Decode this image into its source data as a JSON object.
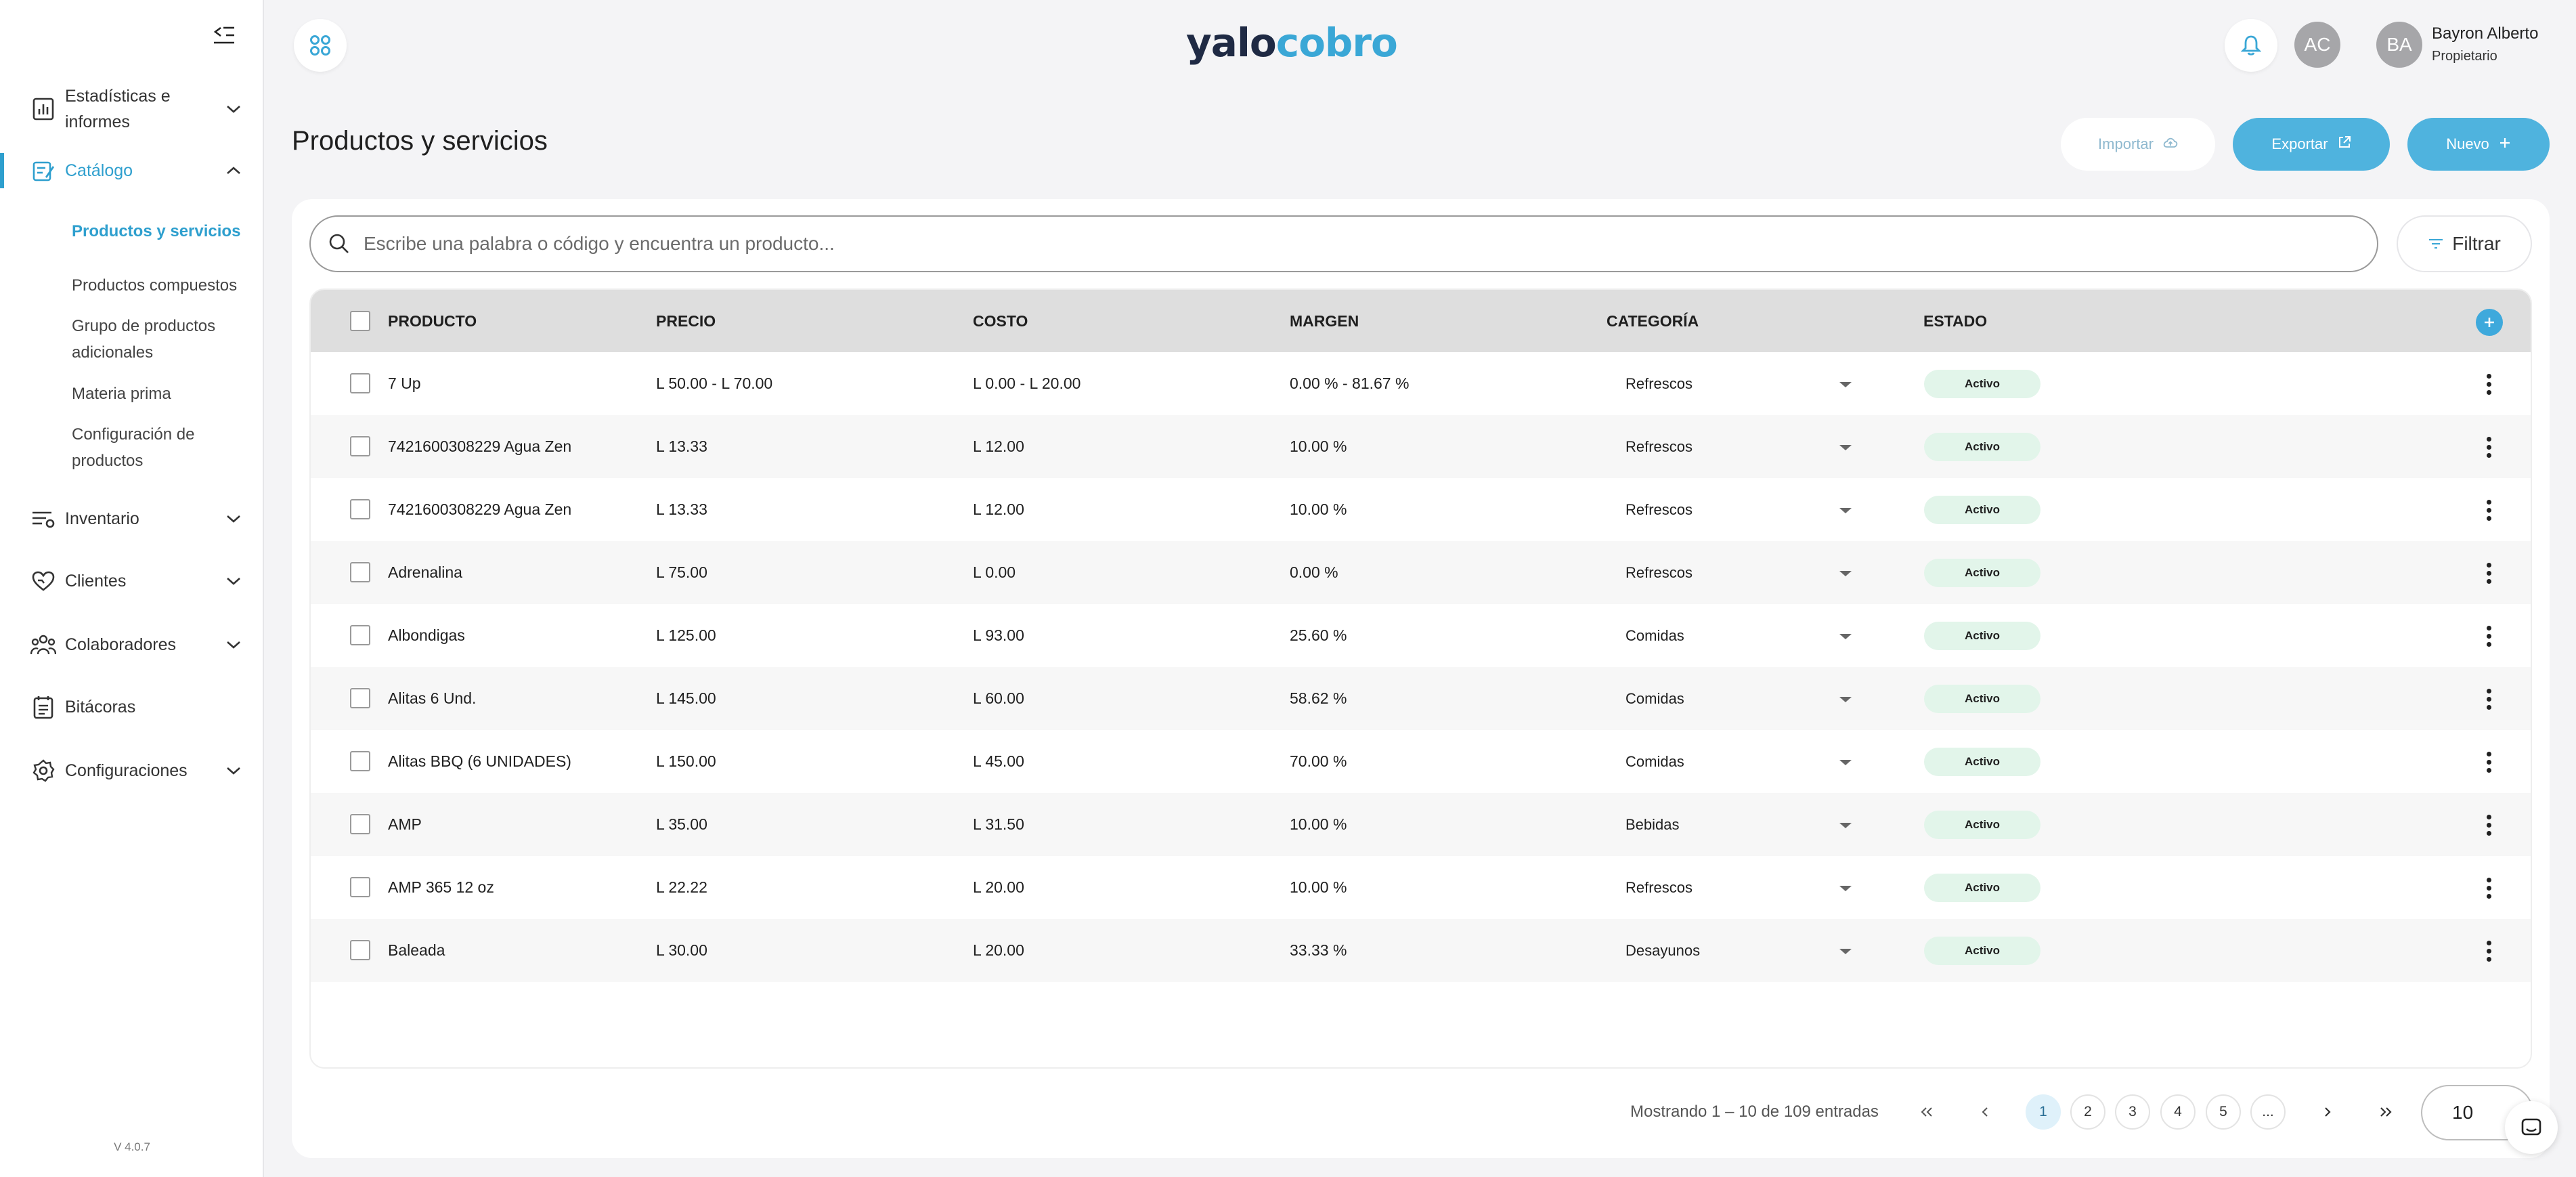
{
  "app": {
    "logo_part1": "yalo",
    "logo_part2": "cobro",
    "version": "V 4.0.7"
  },
  "user": {
    "initials_secondary": "AC",
    "initials": "BA",
    "name": "Bayron Alberto",
    "role": "Propietario"
  },
  "sidebar": {
    "items": [
      {
        "label_line1": "Estadísticas e",
        "label_line2": "informes",
        "icon": "chart-icon"
      },
      {
        "label": "Catálogo",
        "icon": "catalog-icon"
      },
      {
        "label": "Inventario",
        "icon": "inventory-icon"
      },
      {
        "label": "Clientes",
        "icon": "clients-icon"
      },
      {
        "label": "Colaboradores",
        "icon": "collaborators-icon"
      },
      {
        "label": "Bitácoras",
        "icon": "logbook-icon"
      },
      {
        "label": "Configuraciones",
        "icon": "settings-icon"
      }
    ],
    "catalog_sub": {
      "s0": "Productos y servicios",
      "s1": "Productos compuestos",
      "s2a": "Grupo de productos",
      "s2b": "adicionales",
      "s3": "Materia prima",
      "s4a": "Configuración de",
      "s4b": "productos"
    }
  },
  "page": {
    "title": "Productos y servicios",
    "import_label": "Importar",
    "export_label": "Exportar",
    "new_label": "Nuevo",
    "search_placeholder": "Escribe una palabra o código y encuentra un producto...",
    "filter_label": "Filtrar"
  },
  "table": {
    "columns": {
      "product": "PRODUCTO",
      "price": "PRECIO",
      "cost": "COSTO",
      "margin": "MARGEN",
      "category": "CATEGORÍA",
      "status": "ESTADO"
    },
    "rows": [
      {
        "product": "7 Up",
        "price": "L 50.00 - L 70.00",
        "cost": "L 0.00 - L 20.00",
        "margin": "0.00 % - 81.67 %",
        "category": "Refrescos",
        "status": "Activo"
      },
      {
        "product": "7421600308229 Agua Zen",
        "price": "L 13.33",
        "cost": "L 12.00",
        "margin": "10.00 %",
        "category": "Refrescos",
        "status": "Activo"
      },
      {
        "product": "7421600308229 Agua Zen",
        "price": "L 13.33",
        "cost": "L 12.00",
        "margin": "10.00 %",
        "category": "Refrescos",
        "status": "Activo"
      },
      {
        "product": "Adrenalina",
        "price": "L 75.00",
        "cost": "L 0.00",
        "margin": "0.00 %",
        "category": "Refrescos",
        "status": "Activo"
      },
      {
        "product": "Albondigas",
        "price": "L 125.00",
        "cost": "L 93.00",
        "margin": "25.60 %",
        "category": "Comidas",
        "status": "Activo"
      },
      {
        "product": "Alitas 6 Und.",
        "price": "L 145.00",
        "cost": "L 60.00",
        "margin": "58.62 %",
        "category": "Comidas",
        "status": "Activo"
      },
      {
        "product": "Alitas BBQ (6 UNIDADES)",
        "price": "L 150.00",
        "cost": "L 45.00",
        "margin": "70.00 %",
        "category": "Comidas",
        "status": "Activo"
      },
      {
        "product": "AMP",
        "price": "L 35.00",
        "cost": "L 31.50",
        "margin": "10.00 %",
        "category": "Bebidas",
        "status": "Activo"
      },
      {
        "product": "AMP 365 12 oz",
        "price": "L 22.22",
        "cost": "L 20.00",
        "margin": "10.00 %",
        "category": "Refrescos",
        "status": "Activo"
      },
      {
        "product": "Baleada",
        "price": "L 30.00",
        "cost": "L 20.00",
        "margin": "33.33 %",
        "category": "Desayunos",
        "status": "Activo"
      }
    ]
  },
  "pagination": {
    "summary": "Mostrando 1 – 10 de 109 entradas",
    "pages": [
      "1",
      "2",
      "3",
      "4",
      "5",
      "..."
    ],
    "per_page": "10"
  },
  "colors": {
    "accent": "#2e9fce",
    "button": "#4fb3de",
    "status_bg": "#e2f5ea"
  }
}
